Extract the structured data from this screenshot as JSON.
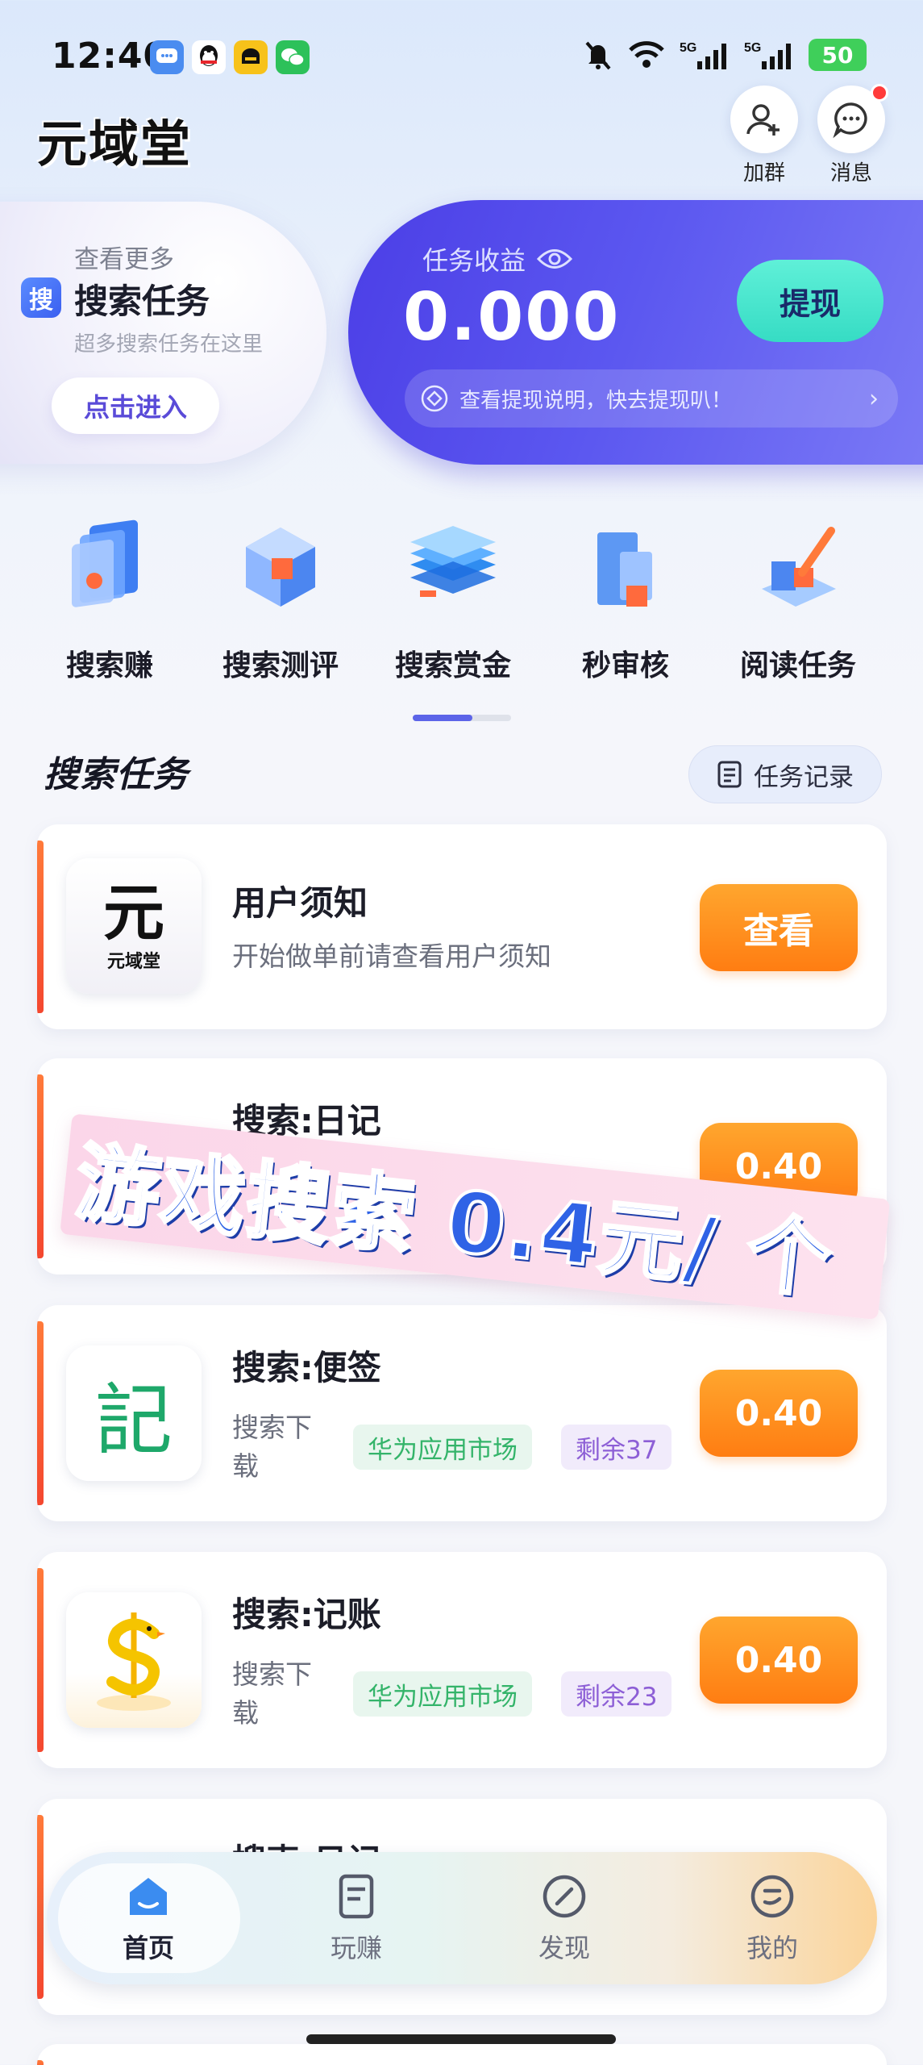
{
  "status_bar": {
    "time": "12:40",
    "network": "5G",
    "battery": "50"
  },
  "header": {
    "logo": "元域堂",
    "join_group_label": "加群",
    "messages_label": "消息"
  },
  "promo": {
    "more": "查看更多",
    "badge": "搜",
    "title": "搜索任务",
    "subtitle": "超多搜索任务在这里",
    "enter_button": "点击进入"
  },
  "earnings": {
    "label": "任务收益",
    "value": "0.000",
    "withdraw_button": "提现",
    "note": "查看提现说明，快去提现叭！"
  },
  "categories": [
    {
      "label": "搜索赚"
    },
    {
      "label": "搜索测评"
    },
    {
      "label": "搜索赏金"
    },
    {
      "label": "秒审核"
    },
    {
      "label": "阅读任务"
    }
  ],
  "section": {
    "title": "搜索任务",
    "record_button": "任务记录"
  },
  "tasks": [
    {
      "title": "用户须知",
      "desc": "开始做单前请查看用户须知",
      "button": "查看",
      "icon_char": "元",
      "icon_sub": "元域堂"
    },
    {
      "title": "搜索:日记",
      "button": "0.40"
    },
    {
      "title": "搜索:便签",
      "desc_line1": "搜索下",
      "desc_line2": "载",
      "tag_store": "华为应用市场",
      "tag_remaining": "剩余37",
      "button": "0.40",
      "icon_char": "記"
    },
    {
      "title": "搜索:记账",
      "desc_line1": "搜索下",
      "desc_line2": "载",
      "tag_store": "华为应用市场",
      "tag_remaining": "剩余23",
      "button": "0.40"
    },
    {
      "title": "搜索:日记"
    }
  ],
  "overlay_banner": "游戏搜索 0.4元/ 个",
  "bottom_nav": [
    {
      "label": "首页",
      "active": true
    },
    {
      "label": "玩赚",
      "active": false
    },
    {
      "label": "发现",
      "active": false
    },
    {
      "label": "我的",
      "active": false
    }
  ],
  "colors": {
    "accent": "#4b3ee6",
    "orange": "#ff8a1c",
    "teal": "#46e3cc"
  }
}
